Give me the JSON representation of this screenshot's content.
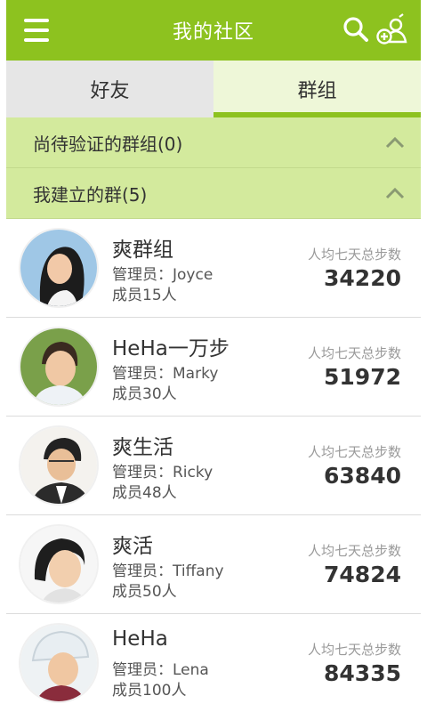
{
  "header": {
    "title": "我的社区",
    "menu_icon": "menu-icon",
    "search_icon": "search-icon",
    "add_group_icon": "add-group-icon"
  },
  "tabs": [
    {
      "label": "好友",
      "selected": false
    },
    {
      "label": "群组",
      "selected": true
    }
  ],
  "sections": {
    "pending": {
      "label": "尚待验证的群组(0)"
    },
    "created": {
      "label": "我建立的群(5)"
    }
  },
  "groups": [
    {
      "name": "爽群组",
      "admin": "管理员：Joyce",
      "members": "成员15人",
      "steps_label": "人均七天总步数",
      "steps": "34220"
    },
    {
      "name": "HeHa一万步",
      "admin": "管理员：Marky",
      "members": "成员30人",
      "steps_label": "人均七天总步数",
      "steps": "51972"
    },
    {
      "name": "爽生活",
      "admin": "管理员：Ricky",
      "members": "成员48人",
      "steps_label": "人均七天总步数",
      "steps": "63840"
    },
    {
      "name": "爽活",
      "admin": "管理员：Tiffany",
      "members": "成员50人",
      "steps_label": "人均七天总步数",
      "steps": "74824"
    },
    {
      "name": "HeHa",
      "admin": "管理员：Lena",
      "members": "成员100人",
      "steps_label": "人均七天总步数",
      "steps": "84335"
    }
  ],
  "colors": {
    "accent": "#8dc21f",
    "section_bg": "#d3ea9d",
    "selected_tab_bg": "#eef7d8"
  }
}
